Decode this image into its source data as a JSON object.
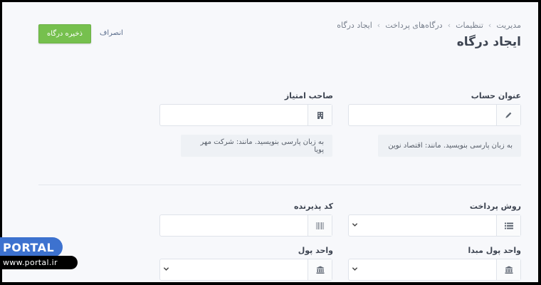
{
  "breadcrumb": {
    "items": [
      "مدیریت",
      "تنظیمات",
      "درگاه‌های پرداخت",
      "ایجاد درگاه"
    ],
    "separator": "›"
  },
  "page": {
    "title": "ایجاد درگاه"
  },
  "actions": {
    "save_label": "ذخیره درگاه",
    "cancel_label": "انصراف"
  },
  "form": {
    "account_title": {
      "label": "عنوان حساب",
      "value": "",
      "hint": "به زبان پارسی بنویسید. مانند: اقتصاد نوین",
      "icon": "pencil-icon"
    },
    "licensee": {
      "label": "صاحب امتیاز",
      "value": "",
      "hint": "به زبان پارسی بنویسید. مانند: شرکت مهر پویا",
      "icon": "building-icon"
    },
    "payment_method": {
      "label": "روش پرداخت",
      "value": "",
      "icon": "list-icon"
    },
    "acceptor_code": {
      "label": "کد پذیرنده",
      "value": "",
      "icon": "barcode-icon"
    },
    "source_currency": {
      "label": "واحد پول مبدا",
      "value": "",
      "icon": "bank-icon"
    },
    "currency": {
      "label": "واحد پول",
      "value": "",
      "icon": "bank-icon"
    }
  },
  "colors": {
    "accent": "#76c04e",
    "brand": "#3d72cf"
  },
  "watermark": {
    "name": "PORTAL",
    "url": "www.portal.ir"
  }
}
